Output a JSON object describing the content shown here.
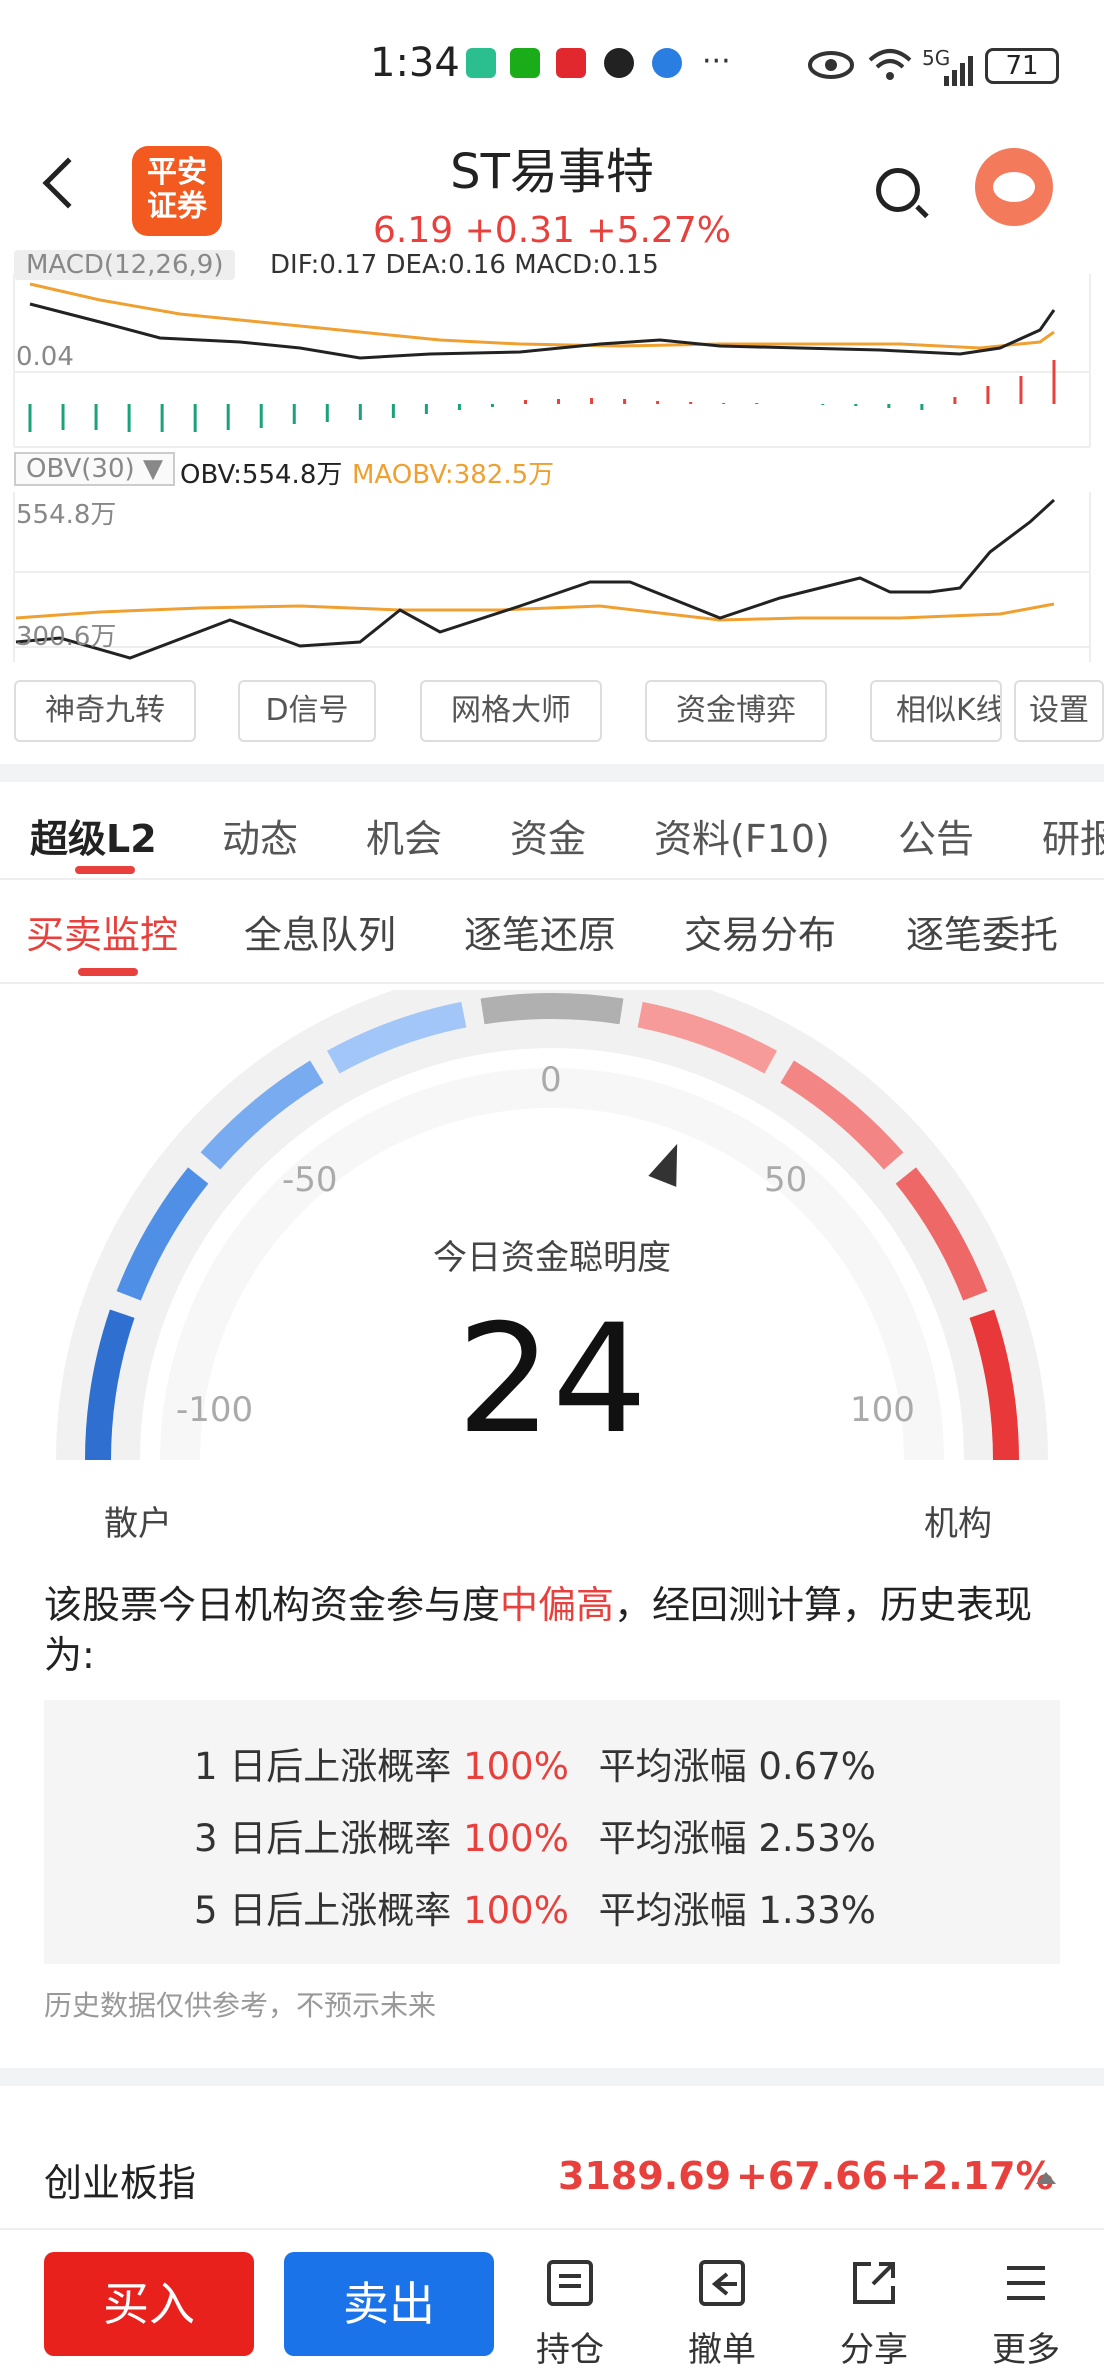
{
  "status": {
    "time": "1:34",
    "battery": "71",
    "network": "5G",
    "more": "···"
  },
  "header": {
    "broker_logo": [
      "平安",
      "证券"
    ],
    "stock_name": "ST易事特",
    "price": "6.19",
    "change": "+0.31",
    "change_pct": "+5.27%"
  },
  "macd": {
    "label": "MACD(12,26,9)",
    "values": "DIF:0.17 DEA:0.16 MACD:0.15",
    "zero_tick": "0.04"
  },
  "obv": {
    "label": "OBV(30)",
    "obv": "OBV:554.8万",
    "maobv": "MAOBV:382.5万",
    "max_tick": "554.8万",
    "min_tick": "300.6万"
  },
  "tools": [
    "神奇九转",
    "D信号",
    "网格大师",
    "资金博弈",
    "相似K线",
    "设置"
  ],
  "main_tabs": [
    "超级L2",
    "动态",
    "机会",
    "资金",
    "资料(F10)",
    "公告",
    "研报"
  ],
  "sub_tabs": [
    "买卖监控",
    "全息队列",
    "逐笔还原",
    "交易分布",
    "逐笔委托"
  ],
  "gauge": {
    "title": "今日资金聪明度",
    "value": "24",
    "value_num": 24,
    "ticks": [
      "0",
      "-50",
      "50",
      "-100",
      "100"
    ],
    "left_label": "散户",
    "right_label": "机构"
  },
  "description": {
    "prefix": "该股票今日机构资金参与度",
    "highlight": "中偏高",
    "suffix": "，经回测计算，历史表现为:"
  },
  "stats": [
    {
      "days": "1 日后上涨概率",
      "prob": "100%",
      "avg_label": "平均涨幅",
      "avg": "0.67%"
    },
    {
      "days": "3 日后上涨概率",
      "prob": "100%",
      "avg_label": "平均涨幅",
      "avg": "2.53%"
    },
    {
      "days": "5 日后上涨概率",
      "prob": "100%",
      "avg_label": "平均涨幅",
      "avg": "1.33%"
    }
  ],
  "note": "历史数据仅供参考，不预示未来",
  "index": {
    "name": "创业板指",
    "value": "3189.69",
    "change": "+67.66",
    "pct": "+2.17%"
  },
  "bottom": {
    "buy": "买入",
    "sell": "卖出",
    "position": "持仓",
    "cancel": "撤单",
    "share": "分享",
    "more": "更多"
  },
  "colors": {
    "red": "#e8403c",
    "blue": "#1a73e8",
    "buy_bg": "#e8211d",
    "sell_bg": "#1a73e8",
    "orange": "#f0a030"
  }
}
